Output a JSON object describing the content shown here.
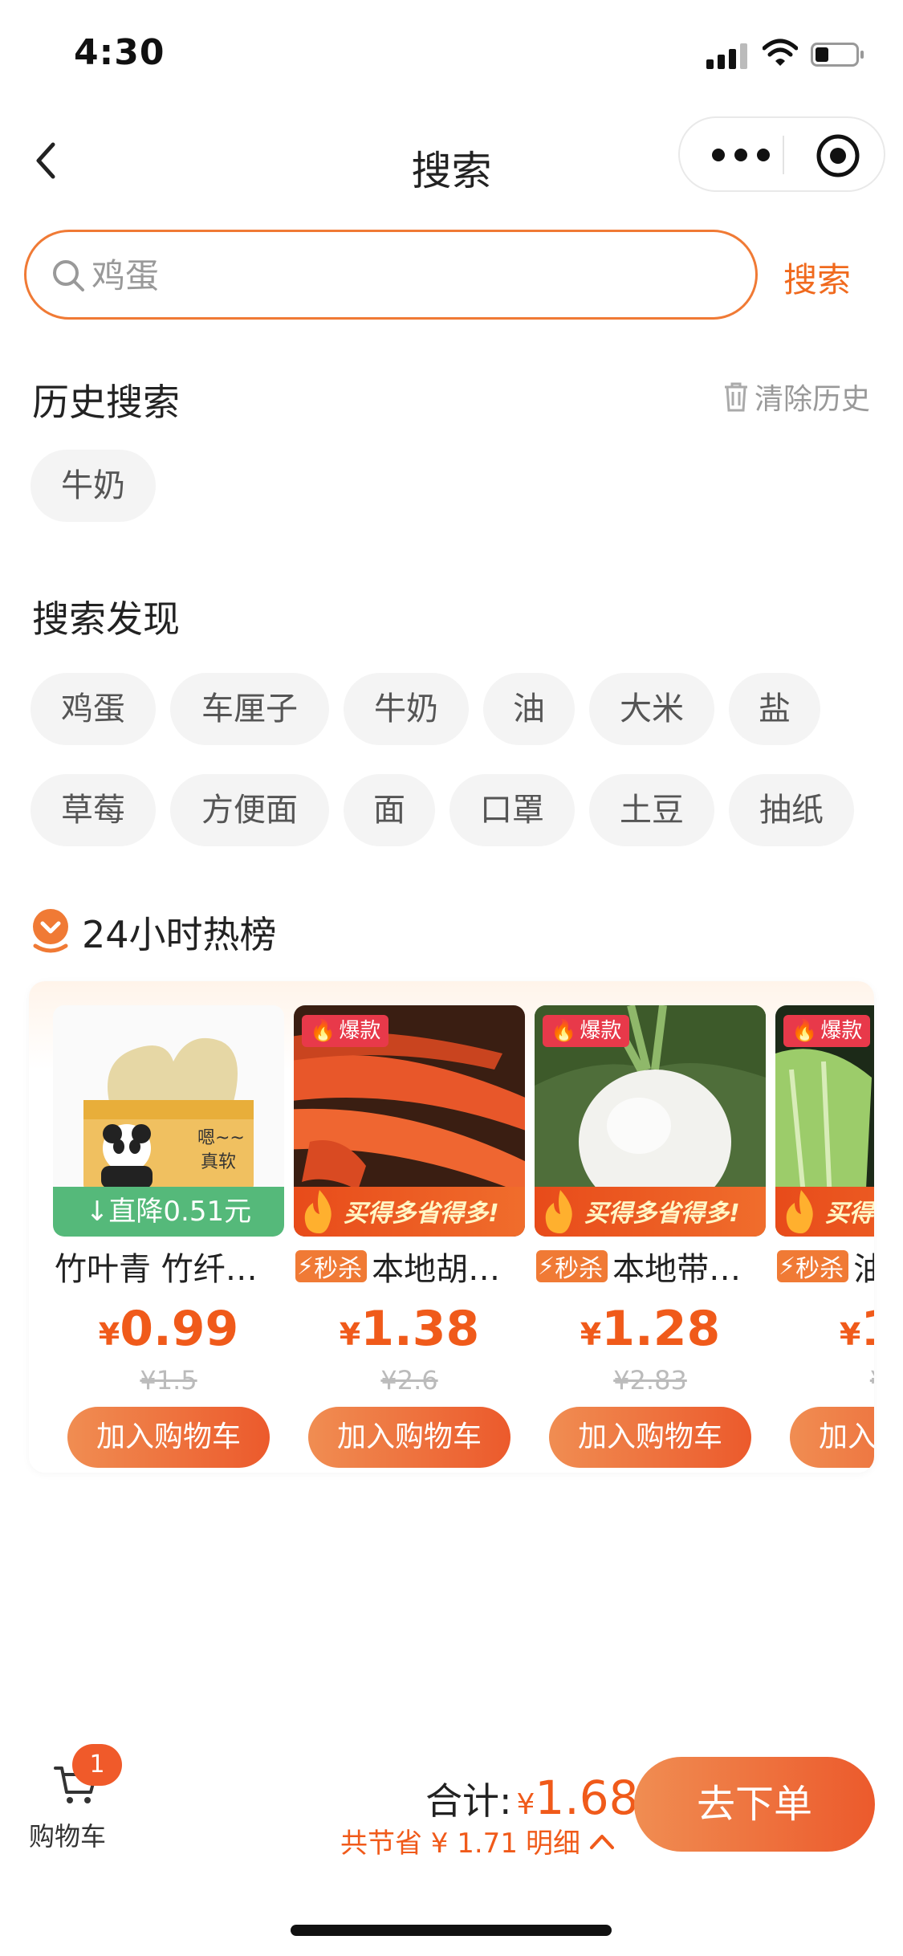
{
  "status_bar": {
    "time": "4:30"
  },
  "nav": {
    "title": "搜索"
  },
  "search": {
    "placeholder": "鸡蛋",
    "value": "",
    "action_label": "搜索"
  },
  "history": {
    "title": "历史搜索",
    "clear_label": "清除历史",
    "items": [
      "牛奶"
    ]
  },
  "discover": {
    "title": "搜索发现",
    "items": [
      "鸡蛋",
      "车厘子",
      "牛奶",
      "油",
      "大米",
      "盐",
      "草莓",
      "方便面",
      "面",
      "口罩",
      "土豆",
      "抽纸"
    ]
  },
  "hot_list": {
    "title": "24小时热榜",
    "products": [
      {
        "name": "竹叶青 竹纤…",
        "tag": "",
        "badge": "",
        "promo": "直降0.51元",
        "price_symbol": "¥",
        "price": "0.99",
        "original_price": "¥1.5",
        "button": "加入购物车"
      },
      {
        "name": "本地胡…",
        "tag": "秒杀",
        "badge": "爆款",
        "promo": "买得多省得多!",
        "price_symbol": "¥",
        "price": "1.38",
        "original_price": "¥2.6",
        "button": "加入购物车"
      },
      {
        "name": "本地带…",
        "tag": "秒杀",
        "badge": "爆款",
        "promo": "买得多省得多!",
        "price_symbol": "¥",
        "price": "1.28",
        "original_price": "¥2.83",
        "button": "加入购物车"
      },
      {
        "name": "油…",
        "tag": "秒杀",
        "badge": "爆款",
        "promo": "买得多省得多!",
        "price_symbol": "¥",
        "price": "1…",
        "original_price": "¥…",
        "button": "加入购物车"
      }
    ]
  },
  "bottom_bar": {
    "cart_label": "购物车",
    "cart_count": "1",
    "total_label": "合计:",
    "total_symbol": "¥",
    "total_amount": "1.68",
    "savings_text": "共节省 ¥ 1.71",
    "detail_label": "明细",
    "checkout_label": "去下单"
  },
  "colors": {
    "accent": "#f06a1e",
    "price": "#f05a1a",
    "green_tag": "#55b97a",
    "hot_badge": "#e8394a"
  },
  "icons": [
    "back-arrow-icon",
    "more-dots-icon",
    "target-icon",
    "search-icon",
    "trash-icon",
    "hot-rank-icon",
    "fire-icon",
    "lightning-icon",
    "arrow-down-icon",
    "cart-icon",
    "chevron-up-icon"
  ]
}
